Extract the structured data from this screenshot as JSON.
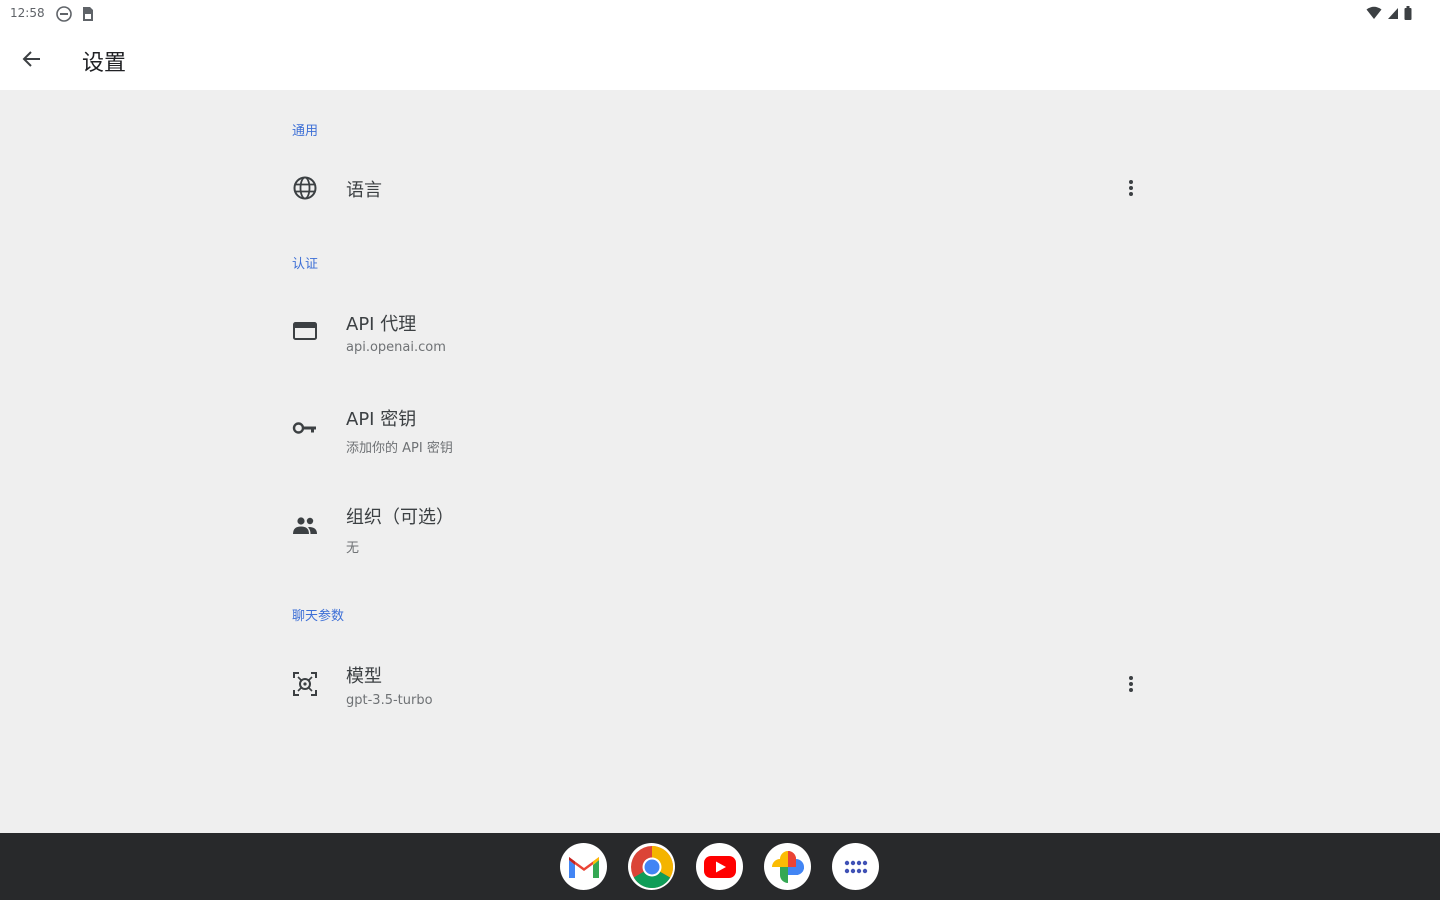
{
  "status_bar": {
    "time": "12:58",
    "left_icons": [
      "dnd-icon",
      "sim-icon"
    ],
    "right_icons": [
      "wifi-icon",
      "signal-icon",
      "battery-icon"
    ]
  },
  "app_bar": {
    "title": "设置",
    "back_icon": "arrow-back-icon"
  },
  "sections": {
    "general": {
      "header": "通用",
      "items": [
        {
          "title": "语言",
          "icon": "globe-icon",
          "has_more": true
        }
      ]
    },
    "auth": {
      "header": "认证",
      "items": [
        {
          "title": "API 代理",
          "summary": "api.openai.com",
          "icon": "web-window-icon"
        },
        {
          "title": "API 密钥",
          "summary": "添加你的 API 密钥",
          "icon": "key-icon"
        },
        {
          "title": "组织（可选）",
          "summary": "无",
          "icon": "group-icon"
        }
      ]
    },
    "chat": {
      "header": "聊天参数",
      "items": [
        {
          "title": "模型",
          "summary": "gpt-3.5-turbo",
          "icon": "model-icon",
          "has_more": true
        }
      ]
    }
  },
  "taskbar": {
    "apps": [
      "gmail-icon",
      "chrome-icon",
      "youtube-icon",
      "photos-icon",
      "app-launcher-icon"
    ]
  },
  "colors": {
    "accent": "#3d6fd6",
    "background": "#efefef",
    "taskbar": "#28292b"
  }
}
